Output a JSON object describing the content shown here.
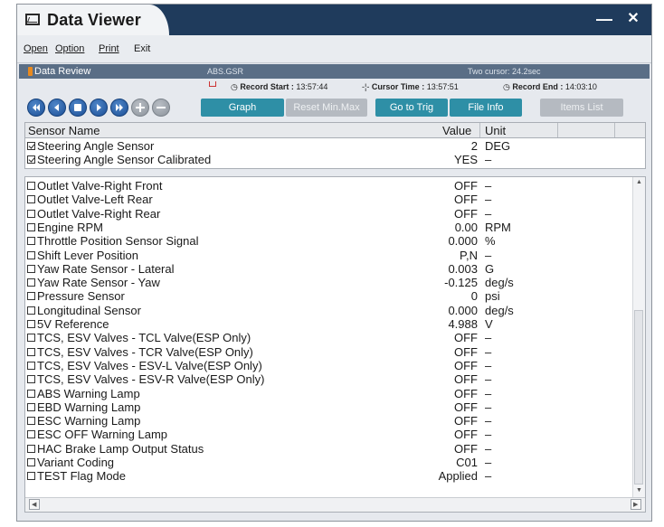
{
  "window": {
    "title": "Data Viewer",
    "minimize_glyph": "—",
    "close_glyph": "✕"
  },
  "menu": {
    "items": [
      "Open",
      "Option",
      "Print",
      "Exit"
    ]
  },
  "review": {
    "title": "Data Review",
    "file": "ABS.GSR",
    "cursor_info": "Two cursor: 24.2sec"
  },
  "record": {
    "start_label": "Record Start :",
    "start_value": "13:57:44",
    "cursor_label": "Cursor Time :",
    "cursor_value": "13:57:51",
    "end_label": "Record End :",
    "end_value": "14:03:10"
  },
  "toolbar": {
    "nav_icons": [
      "skip-back-icon",
      "step-back-icon",
      "stop-icon",
      "play-icon",
      "fast-forward-icon",
      "add-icon",
      "remove-icon"
    ],
    "graph_label": "Graph",
    "reset_label": "Reset Min.Max",
    "trig_label": "Go to Trig",
    "fileinfo_label": "File Info",
    "itemslist_label": "Items List"
  },
  "columns": {
    "name": "Sensor Name",
    "value": "Value",
    "unit": "Unit"
  },
  "selected": [
    {
      "name": "Steering Angle Sensor",
      "value": "2",
      "unit": "DEG",
      "checked": true
    },
    {
      "name": "Steering Angle Sensor Calibrated",
      "value": "YES",
      "unit": "–",
      "checked": true
    }
  ],
  "sensors": [
    {
      "name": "Outlet Valve-Right Front",
      "value": "OFF",
      "unit": "–"
    },
    {
      "name": "Outlet Valve-Left Rear",
      "value": "OFF",
      "unit": "–"
    },
    {
      "name": "Outlet Valve-Right Rear",
      "value": "OFF",
      "unit": "–"
    },
    {
      "name": "Engine RPM",
      "value": "0.00",
      "unit": "RPM"
    },
    {
      "name": "Throttle Position Sensor Signal",
      "value": "0.000",
      "unit": "%"
    },
    {
      "name": "Shift Lever Position",
      "value": "P,N",
      "unit": "–"
    },
    {
      "name": "Yaw Rate Sensor - Lateral",
      "value": "0.003",
      "unit": "G"
    },
    {
      "name": "Yaw Rate Sensor - Yaw",
      "value": "-0.125",
      "unit": "deg/s"
    },
    {
      "name": "Pressure Sensor",
      "value": "0",
      "unit": "psi"
    },
    {
      "name": "Longitudinal Sensor",
      "value": "0.000",
      "unit": "deg/s"
    },
    {
      "name": "5V Reference",
      "value": "4.988",
      "unit": "V"
    },
    {
      "name": "TCS, ESV Valves - TCL Valve(ESP Only)",
      "value": "OFF",
      "unit": "–"
    },
    {
      "name": "TCS, ESV Valves - TCR Valve(ESP Only)",
      "value": "OFF",
      "unit": "–"
    },
    {
      "name": "TCS, ESV Valves - ESV-L Valve(ESP Only)",
      "value": "OFF",
      "unit": "–"
    },
    {
      "name": "TCS, ESV Valves - ESV-R Valve(ESP Only)",
      "value": "OFF",
      "unit": "–"
    },
    {
      "name": "ABS Warning Lamp",
      "value": "OFF",
      "unit": "–"
    },
    {
      "name": "EBD Warning Lamp",
      "value": "OFF",
      "unit": "–"
    },
    {
      "name": "ESC Warning Lamp",
      "value": "OFF",
      "unit": "–"
    },
    {
      "name": "ESC OFF Warning Lamp",
      "value": "OFF",
      "unit": "–"
    },
    {
      "name": "HAC Brake Lamp Output Status",
      "value": "OFF",
      "unit": "–"
    },
    {
      "name": "Variant Coding",
      "value": "C01",
      "unit": "–"
    },
    {
      "name": "TEST Flag Mode",
      "value": "Applied",
      "unit": "–"
    }
  ],
  "colors": {
    "titlebar": "#1f3b5c",
    "review_strip": "#5a6e86",
    "accent_button": "#2e8fa6",
    "nav_button": "#1c4f96"
  }
}
